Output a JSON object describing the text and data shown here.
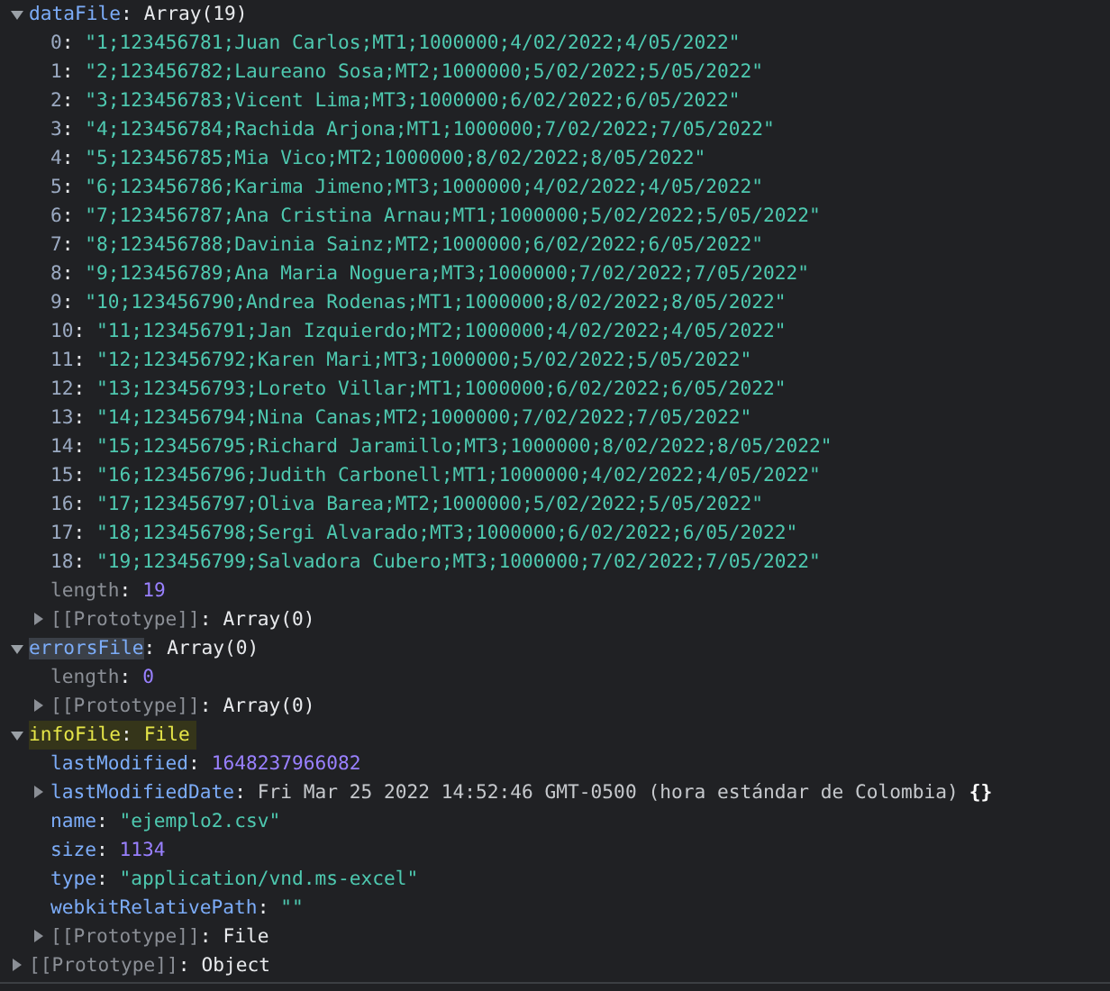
{
  "separator": ":",
  "nodes": [
    {
      "key": "dataFile",
      "hovered": false,
      "search_match": false,
      "dim": false,
      "value": "Array(19)",
      "kind": "object",
      "expanded": true,
      "children": [
        {
          "key": "0",
          "dim": false,
          "value": "\"1;123456781;Juan Carlos;MT1;1000000;4/02/2022;4/05/2022\"",
          "kind": "element"
        },
        {
          "key": "1",
          "dim": false,
          "value": "\"2;123456782;Laureano Sosa;MT2;1000000;5/02/2022;5/05/2022\"",
          "kind": "element"
        },
        {
          "key": "2",
          "dim": false,
          "value": "\"3;123456783;Vicent Lima;MT3;1000000;6/02/2022;6/05/2022\"",
          "kind": "element"
        },
        {
          "key": "3",
          "dim": false,
          "value": "\"4;123456784;Rachida Arjona;MT1;1000000;7/02/2022;7/05/2022\"",
          "kind": "element"
        },
        {
          "key": "4",
          "dim": false,
          "value": "\"5;123456785;Mia Vico;MT2;1000000;8/02/2022;8/05/2022\"",
          "kind": "element"
        },
        {
          "key": "5",
          "dim": false,
          "value": "\"6;123456786;Karima Jimeno;MT3;1000000;4/02/2022;4/05/2022\"",
          "kind": "element"
        },
        {
          "key": "6",
          "dim": false,
          "value": "\"7;123456787;Ana Cristina Arnau;MT1;1000000;5/02/2022;5/05/2022\"",
          "kind": "element"
        },
        {
          "key": "7",
          "dim": false,
          "value": "\"8;123456788;Davinia Sainz;MT2;1000000;6/02/2022;6/05/2022\"",
          "kind": "element"
        },
        {
          "key": "8",
          "dim": false,
          "value": "\"9;123456789;Ana Maria Noguera;MT3;1000000;7/02/2022;7/05/2022\"",
          "kind": "element"
        },
        {
          "key": "9",
          "dim": false,
          "value": "\"10;123456790;Andrea Rodenas;MT1;1000000;8/02/2022;8/05/2022\"",
          "kind": "element"
        },
        {
          "key": "10",
          "dim": false,
          "value": "\"11;123456791;Jan Izquierdo;MT2;1000000;4/02/2022;4/05/2022\"",
          "kind": "element"
        },
        {
          "key": "11",
          "dim": false,
          "value": "\"12;123456792;Karen Mari;MT3;1000000;5/02/2022;5/05/2022\"",
          "kind": "element"
        },
        {
          "key": "12",
          "dim": false,
          "value": "\"13;123456793;Loreto Villar;MT1;1000000;6/02/2022;6/05/2022\"",
          "kind": "element"
        },
        {
          "key": "13",
          "dim": false,
          "value": "\"14;123456794;Nina Canas;MT2;1000000;7/02/2022;7/05/2022\"",
          "kind": "element"
        },
        {
          "key": "14",
          "dim": false,
          "value": "\"15;123456795;Richard Jaramillo;MT3;1000000;8/02/2022;8/05/2022\"",
          "kind": "element"
        },
        {
          "key": "15",
          "dim": false,
          "value": "\"16;123456796;Judith Carbonell;MT1;1000000;4/02/2022;4/05/2022\"",
          "kind": "element"
        },
        {
          "key": "16",
          "dim": false,
          "value": "\"17;123456797;Oliva Barea;MT2;1000000;5/02/2022;5/05/2022\"",
          "kind": "element"
        },
        {
          "key": "17",
          "dim": false,
          "value": "\"18;123456798;Sergi Alvarado;MT3;1000000;6/02/2022;6/05/2022\"",
          "kind": "element"
        },
        {
          "key": "18",
          "dim": false,
          "value": "\"19;123456799;Salvadora Cubero;MT3;1000000;7/02/2022;7/05/2022\"",
          "kind": "element"
        },
        {
          "key": "length",
          "dim": true,
          "value": "19",
          "kind": "number"
        },
        {
          "key": "[[Prototype]]",
          "dim": true,
          "value": "Array(0)",
          "kind": "object",
          "expanded": false
        }
      ]
    },
    {
      "key": "errorsFile",
      "dim": false,
      "value": "Array(0)",
      "kind": "object",
      "expanded": true,
      "hovered": true,
      "search_match": false,
      "children": [
        {
          "key": "length",
          "dim": true,
          "value": "0",
          "kind": "number"
        },
        {
          "key": "[[Prototype]]",
          "dim": true,
          "value": "Array(0)",
          "kind": "object",
          "expanded": false
        }
      ]
    },
    {
      "key": "infoFile",
      "dim": false,
      "value": "File",
      "kind": "object",
      "expanded": true,
      "hovered": false,
      "search_match": true,
      "children": [
        {
          "key": "lastModified",
          "dim": false,
          "value": "1648237966082",
          "kind": "number"
        },
        {
          "key": "lastModifiedDate",
          "dim": false,
          "value": "Fri Mar 25 2022 14:52:46 GMT-0500 (hora estándar de Colombia)",
          "kind": "date",
          "suffix": "{}",
          "expanded": false
        },
        {
          "key": "name",
          "dim": false,
          "value": "\"ejemplo2.csv\"",
          "kind": "string"
        },
        {
          "key": "size",
          "dim": false,
          "value": "1134",
          "kind": "number"
        },
        {
          "key": "type",
          "dim": false,
          "value": "\"application/vnd.ms-excel\"",
          "kind": "string"
        },
        {
          "key": "webkitRelativePath",
          "dim": false,
          "value": "\"\"",
          "kind": "string"
        },
        {
          "key": "[[Prototype]]",
          "dim": true,
          "value": "File",
          "kind": "object",
          "expanded": false
        }
      ]
    },
    {
      "key": "[[Prototype]]",
      "hovered": false,
      "search_match": false,
      "dim": true,
      "value": "Object",
      "kind": "object",
      "expanded": false
    }
  ]
}
